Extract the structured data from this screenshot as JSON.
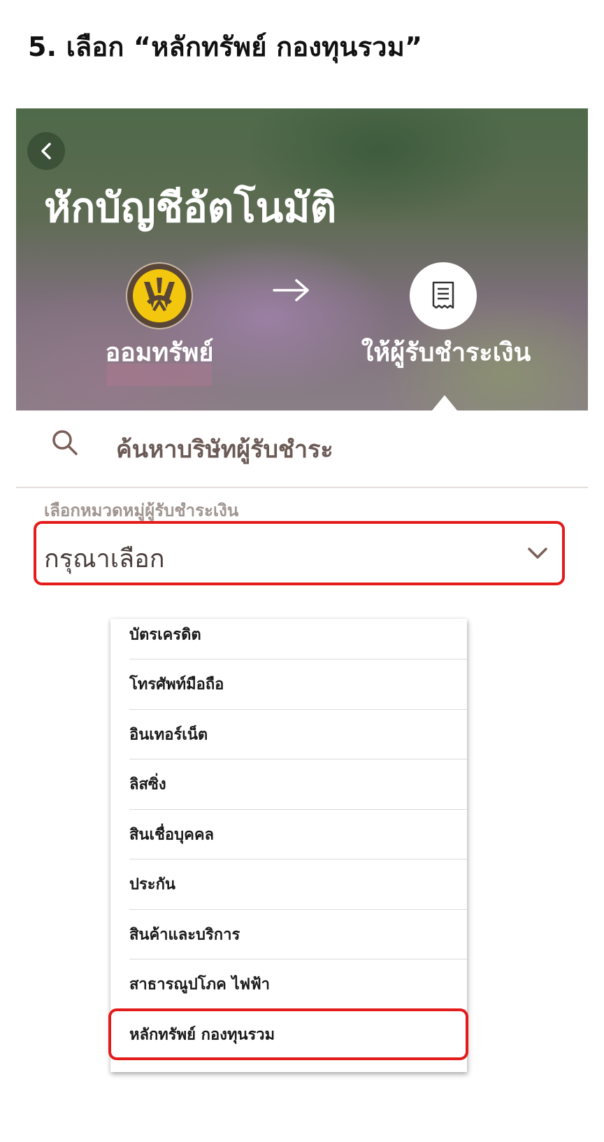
{
  "instruction": {
    "text": "5.  เลือก “หลักทรัพย์  กองทุนรวม”"
  },
  "header": {
    "title": "หักบัญชีอัตโนมัติ",
    "source_label": "ออมทรัพย์",
    "destination_label": "ให้ผู้รับชำระเงิน"
  },
  "search": {
    "placeholder": "ค้นหาบริษัทผู้รับชำระ"
  },
  "category": {
    "label": "เลือกหมวดหมู่ผู้รับชำระเงิน",
    "selected_value": "กรุณาเลือก"
  },
  "dropdown": {
    "options": [
      "บัตรเครดิต",
      "โทรศัพท์มือถือ",
      "อินเทอร์เน็ต",
      "ลิสซิ่ง",
      "สินเชื่อบุคคล",
      "ประกัน",
      "สินค้าและบริการ",
      "สาธารณูปโภค ไฟฟ้า",
      "หลักทรัพย์ กองทุนรวม"
    ],
    "highlighted_option": "หลักทรัพย์ กองทุนรวม"
  },
  "colors": {
    "highlight": "#e31b1b",
    "bank_logo_yellow": "#f4c70f",
    "bank_logo_brown": "#5a4636"
  },
  "icons": {
    "back": "chevron-left-icon",
    "transfer": "arrow-right-icon",
    "destination": "receipt-icon",
    "search": "search-icon",
    "select": "chevron-down-icon"
  }
}
